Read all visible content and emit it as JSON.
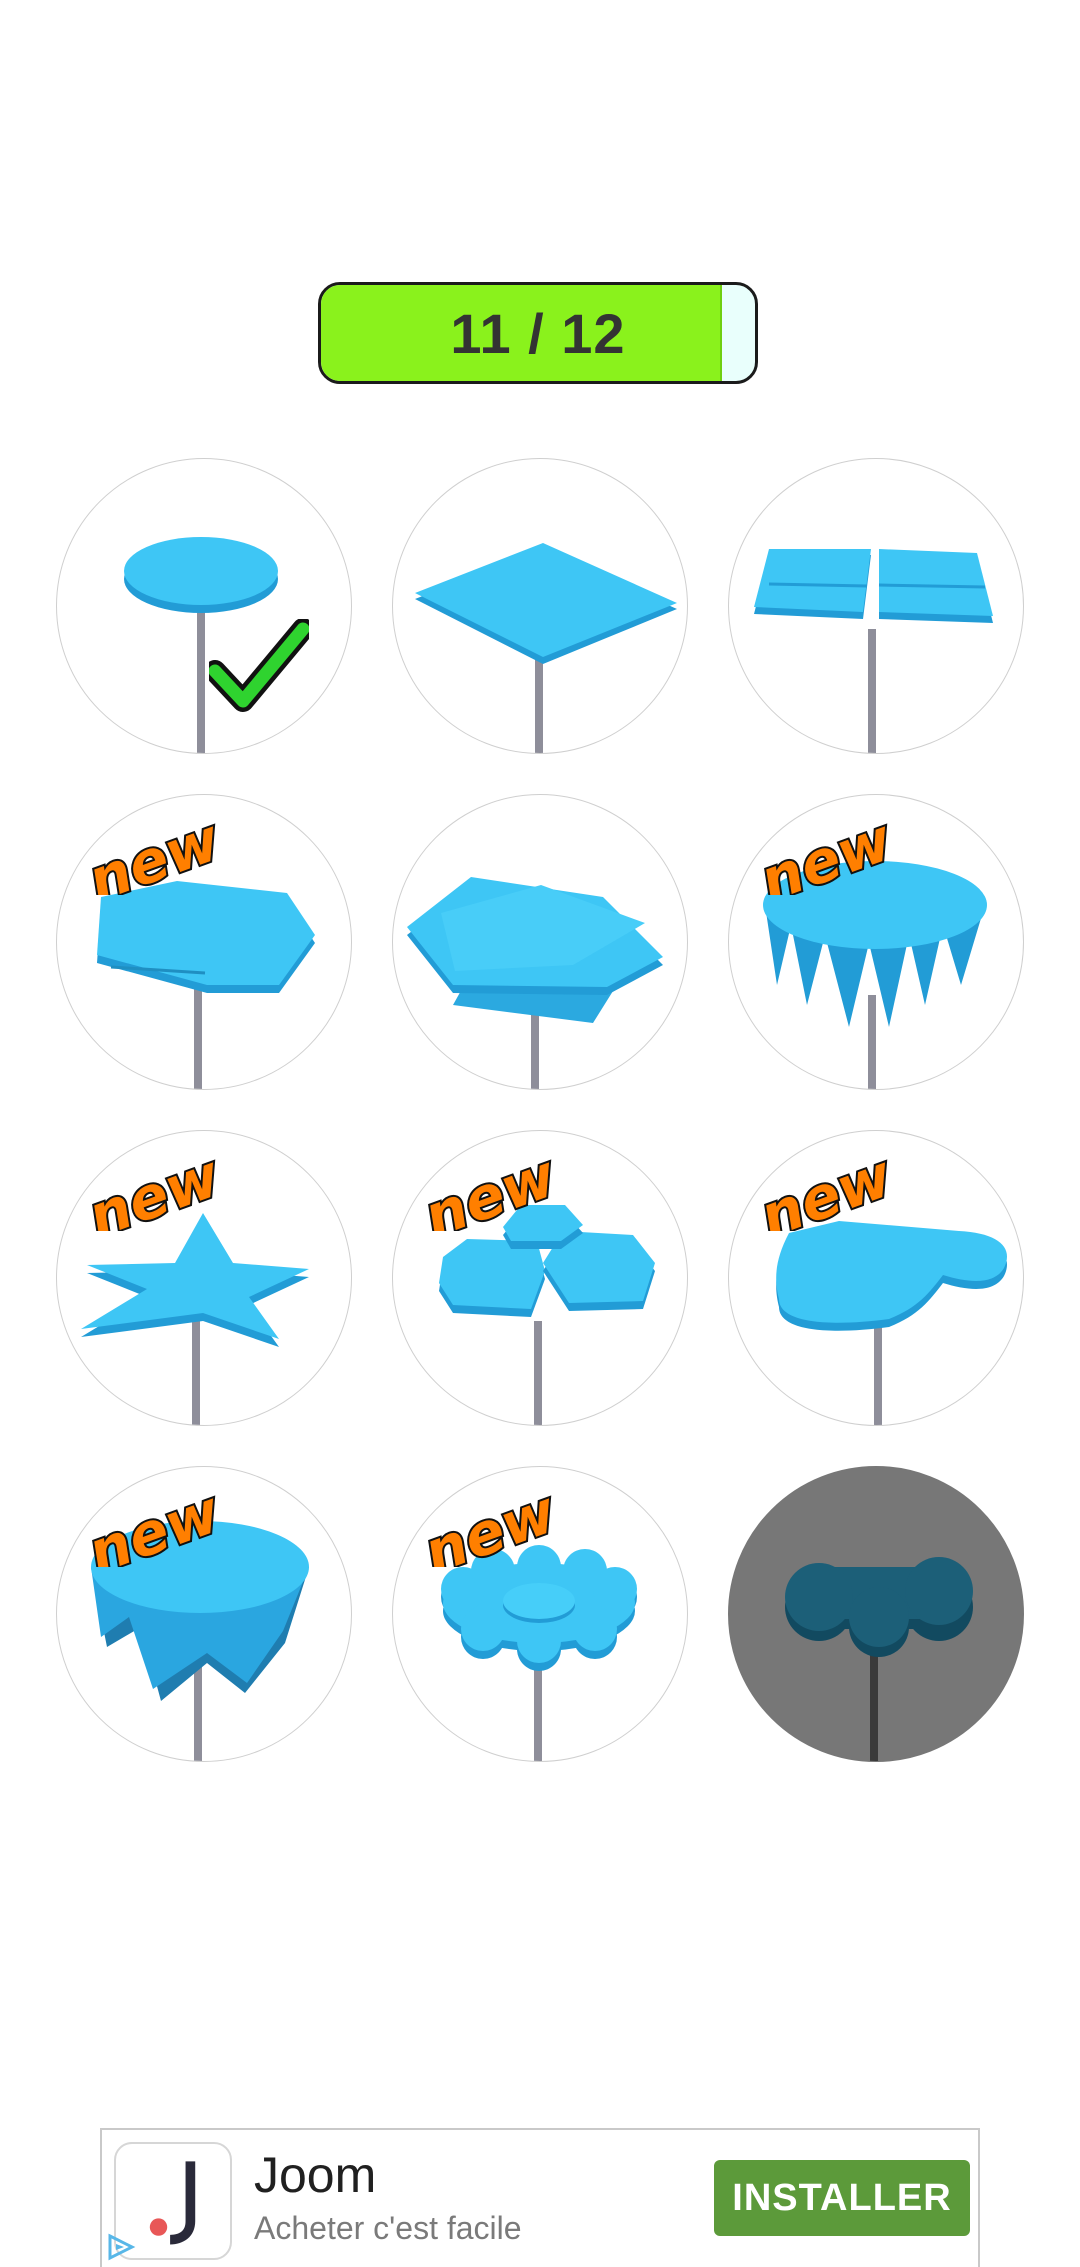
{
  "progress": {
    "label": "11 / 12",
    "current": 11,
    "total": 12,
    "fill_fraction": 0.92
  },
  "colors": {
    "progress_fill": "#8af21c",
    "shape": "#3ec6f5",
    "shape_dark": "#229cd6",
    "locked_bg": "#777777",
    "new_fill": "#ff7f00",
    "check": "#2fd32f"
  },
  "new_badge": "new",
  "items": [
    {
      "shape": "circle-table",
      "state": "selected",
      "is_new": false
    },
    {
      "shape": "square-table",
      "state": "unlocked",
      "is_new": false
    },
    {
      "shape": "split-square-table",
      "state": "unlocked",
      "is_new": false
    },
    {
      "shape": "hexagon-table",
      "state": "unlocked",
      "is_new": true
    },
    {
      "shape": "layered-square-table",
      "state": "unlocked",
      "is_new": false
    },
    {
      "shape": "spiked-round-table",
      "state": "unlocked",
      "is_new": true
    },
    {
      "shape": "star-table",
      "state": "unlocked",
      "is_new": true
    },
    {
      "shape": "triple-hexagon-table",
      "state": "unlocked",
      "is_new": true
    },
    {
      "shape": "heart-table",
      "state": "unlocked",
      "is_new": true
    },
    {
      "shape": "tablecloth-table",
      "state": "unlocked",
      "is_new": true
    },
    {
      "shape": "flower-table",
      "state": "unlocked",
      "is_new": true
    },
    {
      "shape": "cloud-table",
      "state": "locked",
      "is_new": false
    }
  ],
  "ad": {
    "app_name": "Joom",
    "tagline": "Acheter c'est facile",
    "button": "INSTALLER",
    "button_color": "#5c9a3a",
    "icon": "joom-logo-icon",
    "adchoices_icon": "adchoices-icon"
  }
}
